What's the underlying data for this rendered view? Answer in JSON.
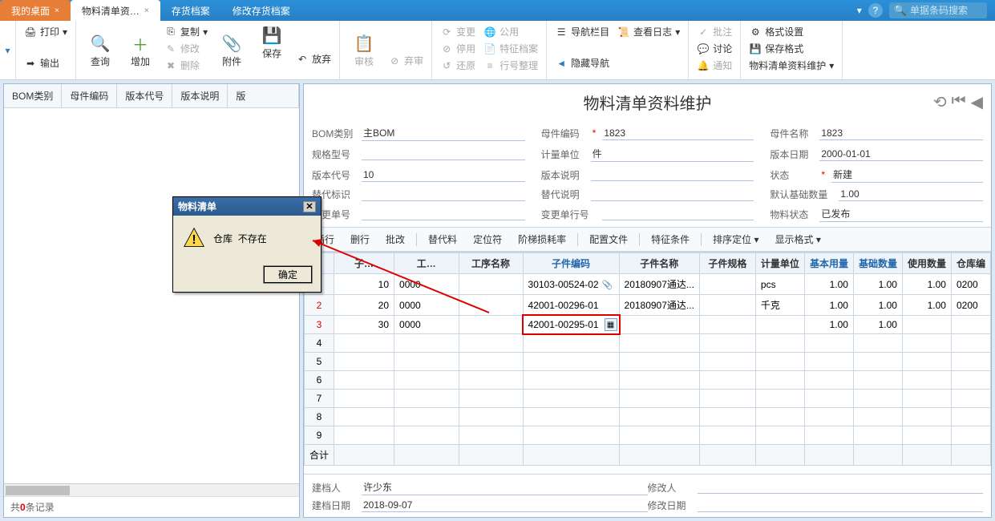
{
  "tabs": {
    "t0": "我的桌面",
    "t1": "物料清单资…",
    "t2": "存货档案",
    "t3": "修改存货档案"
  },
  "search": {
    "placeholder": "单据条码搜索"
  },
  "ribbon": {
    "print": "打印",
    "output": "输出",
    "query": "查询",
    "add": "增加",
    "copy": "复制",
    "modify": "修改",
    "delete": "删除",
    "attach": "附件",
    "save": "保存",
    "discard": "放弃",
    "audit": "审核",
    "unaudit": "弃审",
    "change": "变更",
    "disable": "停用",
    "restore": "还原",
    "public": "公用",
    "feature_file": "特征档案",
    "row_organize": "行号整理",
    "nav": "导航栏目",
    "log": "查看日志",
    "hide_nav": "隐藏导航",
    "approve": "批注",
    "discuss": "讨论",
    "notify": "通知",
    "format": "格式设置",
    "save_format": "保存格式",
    "maintain": "物料清单资料维护"
  },
  "left": {
    "h0": "BOM类别",
    "h1": "母件编码",
    "h2": "版本代号",
    "h3": "版本说明",
    "h4": "版",
    "footer_prefix": "共",
    "footer_count": "0",
    "footer_suffix": "条记录"
  },
  "title": "物料清单资料维护",
  "form": {
    "l_bom_type": "BOM类别",
    "v_bom_type": "主BOM",
    "l_parent_code": "母件编码",
    "v_parent_code": "1823",
    "l_parent_name": "母件名称",
    "v_parent_name": "1823",
    "l_spec": "规格型号",
    "v_spec": "",
    "l_unit": "计量单位",
    "v_unit": "件",
    "l_ver_date": "版本日期",
    "v_ver_date": "2000-01-01",
    "l_ver_code": "版本代号",
    "v_ver_code": "10",
    "l_ver_desc": "版本说明",
    "v_ver_desc": "",
    "l_status": "状态",
    "v_status": "新建",
    "l_alt_flag": "替代标识",
    "v_alt_flag": "",
    "l_alt_desc": "替代说明",
    "v_alt_desc": "",
    "l_base_qty": "默认基础数量",
    "v_base_qty": "1.00",
    "l_change_no": "变更单号",
    "v_change_no": "",
    "l_change_line": "变更单行号",
    "v_change_line": "",
    "l_mat_status": "物料状态",
    "v_mat_status": "已发布"
  },
  "grid_toolbar": {
    "insert": "插行",
    "delete": "删行",
    "batch": "批改",
    "alt": "替代料",
    "locate": "定位符",
    "step": "阶梯损耗率",
    "config": "配置文件",
    "feature": "特征条件",
    "sort": "排序定位",
    "display": "显示格式"
  },
  "grid": {
    "h_sub": "子…",
    "h_gong": "工…",
    "h_process": "工序名称",
    "h_code": "子件编码",
    "h_name": "子件名称",
    "h_spec": "子件规格",
    "h_unit": "计量单位",
    "h_base": "基本用量",
    "h_base_qty": "基础数量",
    "h_use": "使用数量",
    "h_wh": "仓库编",
    "rows": [
      {
        "n": "1",
        "sub": "10",
        "gong": "0000",
        "code": "30103-00524-02",
        "name": "20180907通达...",
        "unit": "pcs",
        "base": "1.00",
        "bqty": "1.00",
        "use": "1.00",
        "wh": "0200"
      },
      {
        "n": "2",
        "sub": "20",
        "gong": "0000",
        "code": "42001-00296-01",
        "name": "20180907通达...",
        "unit": "千克",
        "base": "1.00",
        "bqty": "1.00",
        "use": "1.00",
        "wh": "0200"
      },
      {
        "n": "3",
        "sub": "30",
        "gong": "0000",
        "code": "42001-00295-01",
        "name": "",
        "unit": "",
        "base": "1.00",
        "bqty": "1.00",
        "use": "",
        "wh": ""
      }
    ],
    "sum_label": "合计"
  },
  "bottom": {
    "l_creator": "建档人",
    "v_creator": "许少东",
    "l_modifier": "修改人",
    "v_modifier": "",
    "l_cdate": "建档日期",
    "v_cdate": "2018-09-07",
    "l_mdate": "修改日期",
    "v_mdate": ""
  },
  "dialog": {
    "title": "物料清单",
    "msg1": "仓库",
    "msg2": "不存在",
    "ok": "确定"
  }
}
